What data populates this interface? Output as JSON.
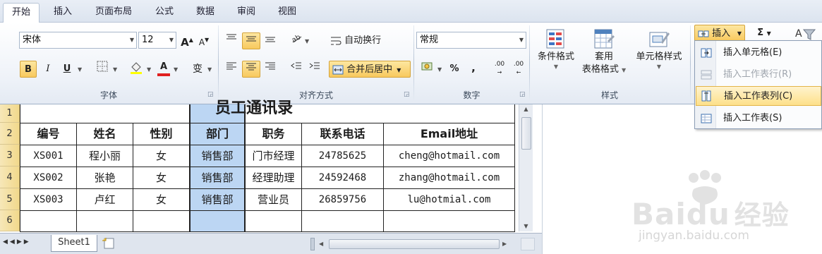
{
  "tabs": [
    "开始",
    "插入",
    "页面布局",
    "公式",
    "数据",
    "审阅",
    "视图"
  ],
  "font": {
    "name": "宋体",
    "size": "12",
    "bold": "B",
    "italic": "I",
    "underline": "U",
    "grow": "A",
    "shrink": "A",
    "phonetic": "变"
  },
  "align": {
    "wrap": "自动换行",
    "merge": "合并后居中"
  },
  "number": {
    "format": "常规",
    "percent": "%",
    "comma": ",",
    "inc": ".00",
    "dec": ".00"
  },
  "styles": {
    "cond": "条件格式",
    "table_line1": "套用",
    "table_line2": "表格格式",
    "cell": "单元格样式"
  },
  "cells_group": {
    "insert": "插入",
    "sigma": "Σ"
  },
  "groups": {
    "font": "字体",
    "align": "对齐方式",
    "number": "数字",
    "styles": "样式"
  },
  "insert_menu": [
    {
      "label": "插入单元格(E)",
      "icon": "insert-cells-icon",
      "disabled": false,
      "hot": false
    },
    {
      "label": "插入工作表行(R)",
      "icon": "insert-row-icon",
      "disabled": true,
      "hot": false
    },
    {
      "label": "插入工作表列(C)",
      "icon": "insert-column-icon",
      "disabled": false,
      "hot": true
    },
    {
      "label": "插入工作表(S)",
      "icon": "insert-sheet-icon",
      "disabled": false,
      "hot": false
    }
  ],
  "sheet": {
    "title_fragment": "员工通讯录",
    "row_numbers": [
      "1",
      "2",
      "3",
      "4",
      "5",
      "6"
    ],
    "headers": [
      "编号",
      "姓名",
      "性别",
      "部门",
      "职务",
      "联系电话",
      "Email地址"
    ],
    "rows": [
      [
        "XS001",
        "程小丽",
        "女",
        "销售部",
        "门市经理",
        "24785625",
        "cheng@hotmail.com"
      ],
      [
        "XS002",
        "张艳",
        "女",
        "销售部",
        "经理助理",
        "24592468",
        "zhang@hotmail.com"
      ],
      [
        "XS003",
        "卢红",
        "女",
        "销售部",
        "营业员",
        "26859756",
        "lu@hotmial.com"
      ]
    ],
    "sheet_tab": "Sheet1"
  },
  "watermark": {
    "brand": "Baidu",
    "cn": "经验",
    "url": "jingyan.baidu.com"
  },
  "colors": {
    "accent": "#f8c95d",
    "selection": "#bcd6f3",
    "rowheader": "#f2d98c"
  }
}
